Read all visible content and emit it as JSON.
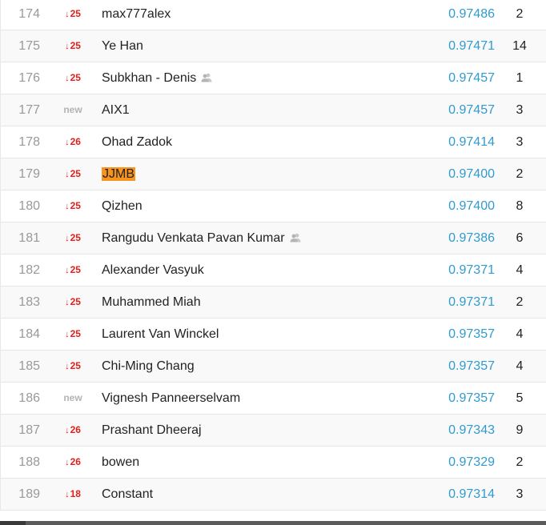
{
  "leaderboard": {
    "rows": [
      {
        "rank": "174",
        "delta": "25",
        "delta_type": "down",
        "team": "max777alex",
        "team_icon": false,
        "highlight": false,
        "score": "0.97486",
        "entries": "2"
      },
      {
        "rank": "175",
        "delta": "25",
        "delta_type": "down",
        "team": "Ye Han",
        "team_icon": false,
        "highlight": false,
        "score": "0.97471",
        "entries": "14"
      },
      {
        "rank": "176",
        "delta": "25",
        "delta_type": "down",
        "team": "Subkhan - Denis",
        "team_icon": true,
        "highlight": false,
        "score": "0.97457",
        "entries": "1"
      },
      {
        "rank": "177",
        "delta": "new",
        "delta_type": "new",
        "team": "AIX1",
        "team_icon": false,
        "highlight": false,
        "score": "0.97457",
        "entries": "3"
      },
      {
        "rank": "178",
        "delta": "26",
        "delta_type": "down",
        "team": "Ohad Zadok",
        "team_icon": false,
        "highlight": false,
        "score": "0.97414",
        "entries": "3"
      },
      {
        "rank": "179",
        "delta": "25",
        "delta_type": "down",
        "team": "JJMB",
        "team_icon": false,
        "highlight": true,
        "score": "0.97400",
        "entries": "2"
      },
      {
        "rank": "180",
        "delta": "25",
        "delta_type": "down",
        "team": "Qizhen",
        "team_icon": false,
        "highlight": false,
        "score": "0.97400",
        "entries": "8"
      },
      {
        "rank": "181",
        "delta": "25",
        "delta_type": "down",
        "team": "Rangudu Venkata Pavan Kumar",
        "team_icon": true,
        "highlight": false,
        "score": "0.97386",
        "entries": "6"
      },
      {
        "rank": "182",
        "delta": "25",
        "delta_type": "down",
        "team": "Alexander Vasyuk",
        "team_icon": false,
        "highlight": false,
        "score": "0.97371",
        "entries": "4"
      },
      {
        "rank": "183",
        "delta": "25",
        "delta_type": "down",
        "team": "Muhammed Miah",
        "team_icon": false,
        "highlight": false,
        "score": "0.97371",
        "entries": "2"
      },
      {
        "rank": "184",
        "delta": "25",
        "delta_type": "down",
        "team": "Laurent Van Winckel",
        "team_icon": false,
        "highlight": false,
        "score": "0.97357",
        "entries": "4"
      },
      {
        "rank": "185",
        "delta": "25",
        "delta_type": "down",
        "team": "Chi-Ming Chang",
        "team_icon": false,
        "highlight": false,
        "score": "0.97357",
        "entries": "4"
      },
      {
        "rank": "186",
        "delta": "new",
        "delta_type": "new",
        "team": "Vignesh Panneerselvam",
        "team_icon": false,
        "highlight": false,
        "score": "0.97357",
        "entries": "5"
      },
      {
        "rank": "187",
        "delta": "26",
        "delta_type": "down",
        "team": "Prashant Dheeraj",
        "team_icon": false,
        "highlight": false,
        "score": "0.97343",
        "entries": "9"
      },
      {
        "rank": "188",
        "delta": "26",
        "delta_type": "down",
        "team": "bowen",
        "team_icon": false,
        "highlight": false,
        "score": "0.97329",
        "entries": "2"
      },
      {
        "rank": "189",
        "delta": "18",
        "delta_type": "down",
        "team": "Constant",
        "team_icon": false,
        "highlight": false,
        "score": "0.97314",
        "entries": "3"
      }
    ]
  },
  "colors": {
    "delta_down": "#e0201a",
    "delta_new": "#b3b3b3",
    "score": "#2f9bd1",
    "highlight": "#f7941d"
  },
  "icons": {
    "delta_down": "down-arrow-icon",
    "team_member": "team-members-icon"
  }
}
